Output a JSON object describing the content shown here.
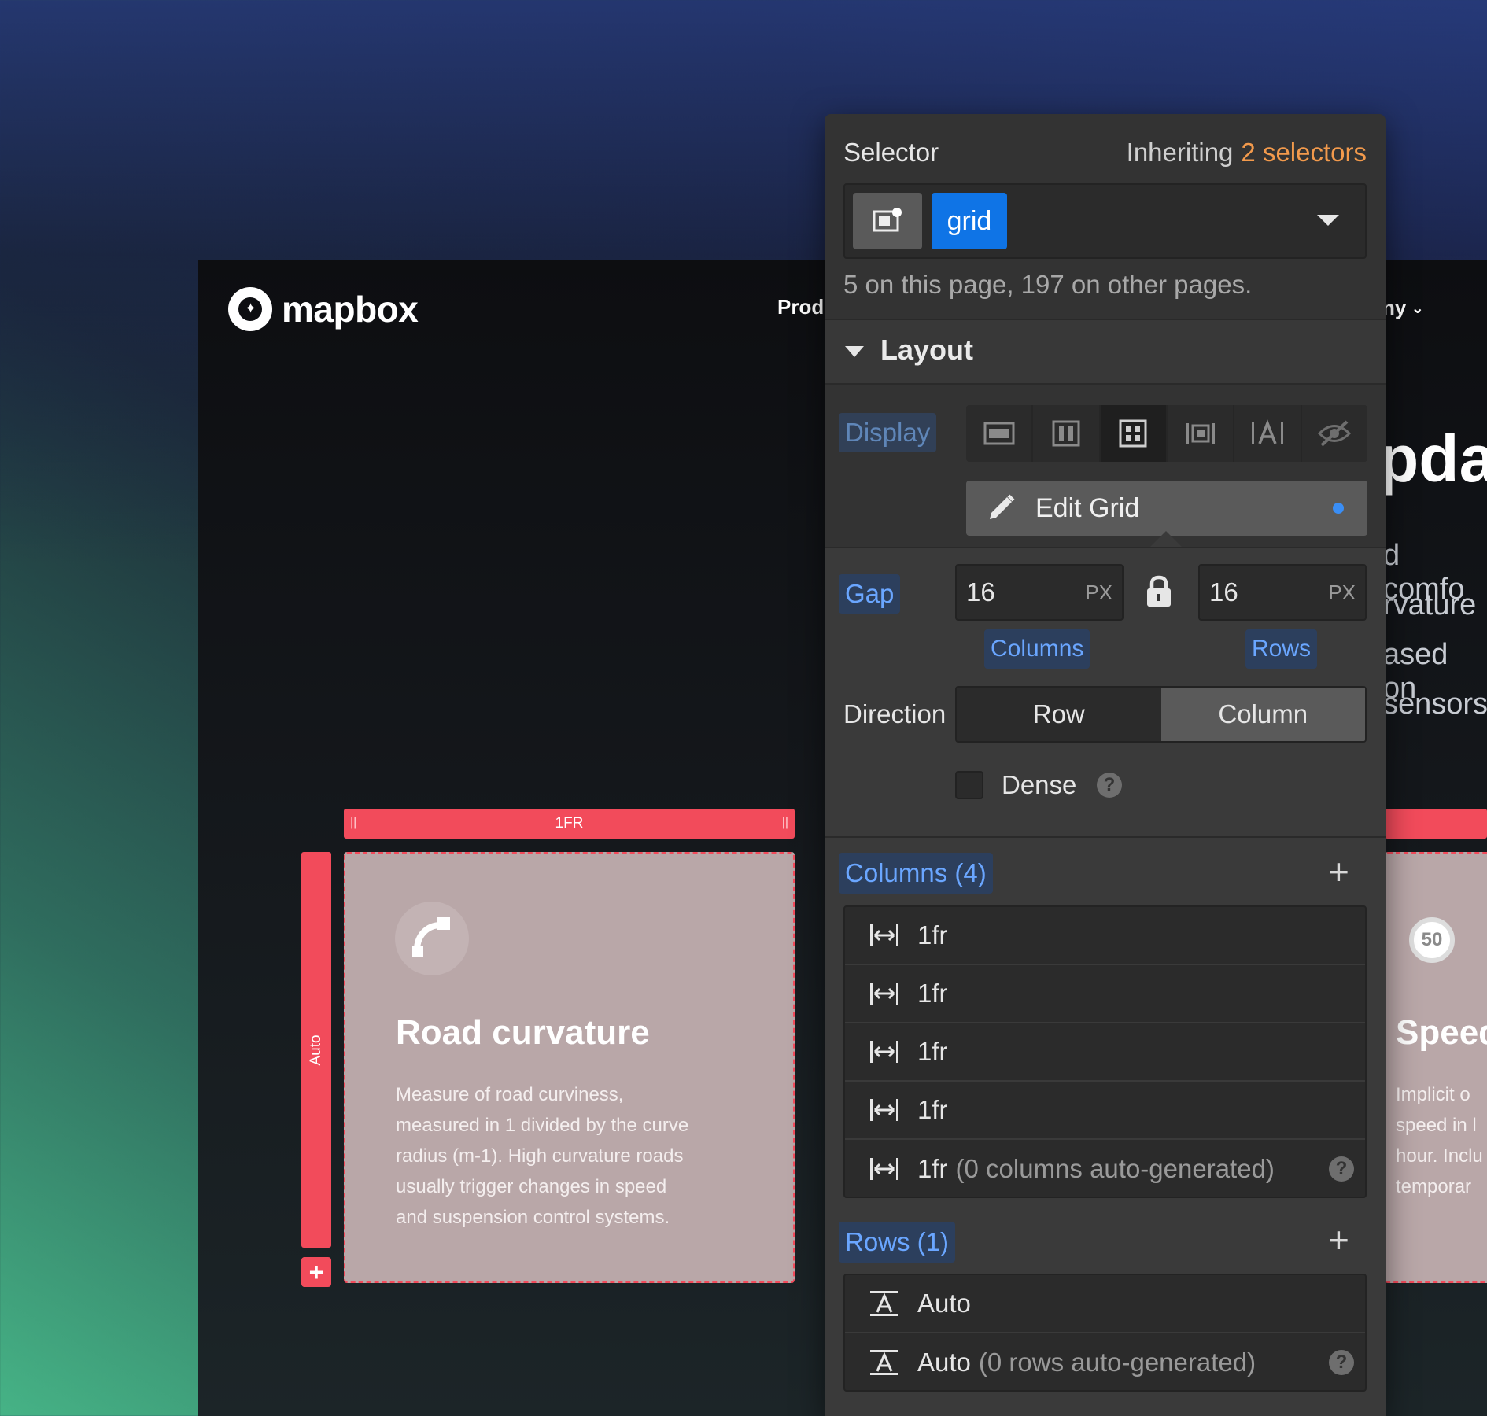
{
  "site": {
    "logo_text": "mapbox",
    "nav_left": "Prod",
    "nav_right": "ny",
    "hero_fragment": "pda",
    "hero_lines": [
      "d comfo",
      "rvature",
      "ased on",
      "sensors"
    ]
  },
  "grid_overlay": {
    "column_label": "1FR",
    "row_label": "Auto",
    "add_row": "+"
  },
  "card_main": {
    "title": "Road curvature",
    "text_lines": [
      "Measure of road curviness,",
      "measured in 1 divided by the curve",
      "radius (m-1). High curvature roads",
      "usually trigger changes in speed",
      "and suspension control systems."
    ]
  },
  "card_side": {
    "badge": "50",
    "title": "Speed",
    "text_lines": [
      "Implicit o",
      "speed in l",
      "hour. Inclu",
      "temporar"
    ]
  },
  "panel": {
    "selector_label": "Selector",
    "inheriting_prefix": "Inheriting",
    "inheriting_count": "2 selectors",
    "chip": "grid",
    "usage": "5 on this page, 197 on other pages.",
    "layout_title": "Layout",
    "display_label": "Display",
    "edit_grid": "Edit Grid",
    "gap_label": "Gap",
    "gap_columns_value": "16",
    "gap_rows_value": "16",
    "unit": "PX",
    "columns_label": "Columns",
    "rows_label": "Rows",
    "direction_label": "Direction",
    "direction_row": "Row",
    "direction_column": "Column",
    "dense_label": "Dense",
    "columns_header": "Columns (4)",
    "columns": [
      {
        "value": "1fr",
        "note": ""
      },
      {
        "value": "1fr",
        "note": ""
      },
      {
        "value": "1fr",
        "note": ""
      },
      {
        "value": "1fr",
        "note": ""
      },
      {
        "value": "1fr",
        "note": "(0 columns auto-generated)"
      }
    ],
    "rows_header": "Rows (1)",
    "rows": [
      {
        "value": "Auto",
        "note": ""
      },
      {
        "value": "Auto",
        "note": "(0 rows auto-generated)"
      }
    ],
    "help": "?"
  },
  "colors": {
    "accent_blue": "#0f74e6",
    "grid_red": "#f24b5b",
    "inherit_orange": "#f39a4c"
  }
}
